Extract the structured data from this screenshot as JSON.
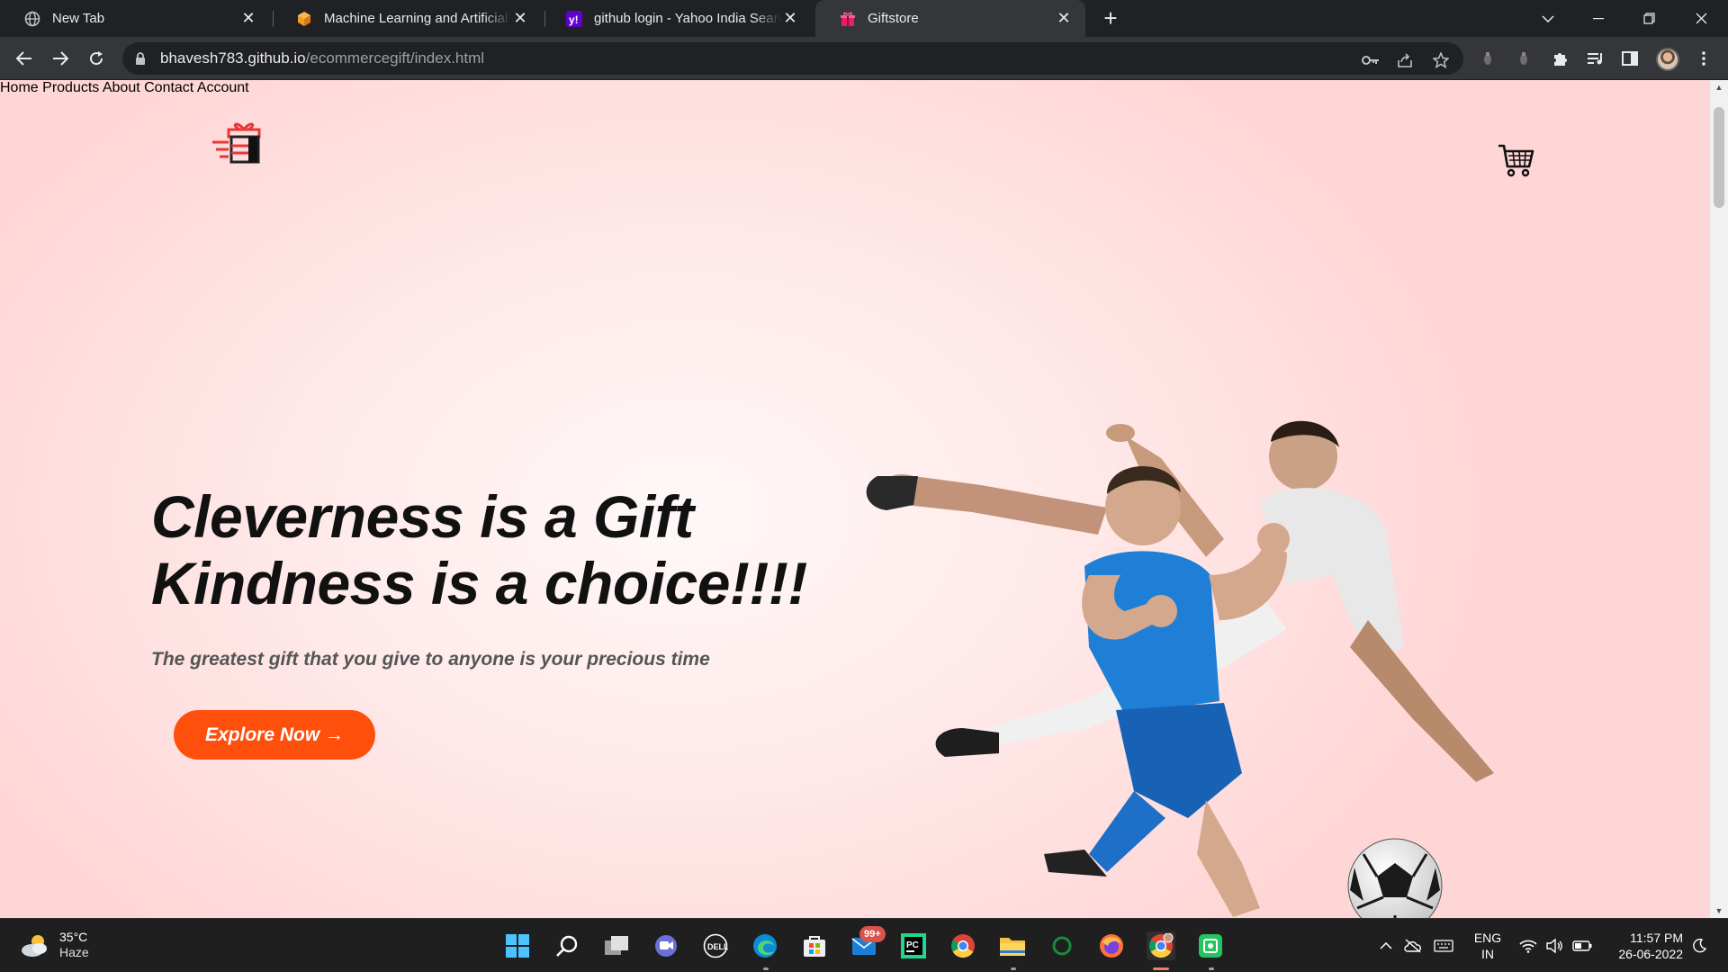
{
  "browser": {
    "tabs": [
      {
        "title": "New Tab",
        "icon": "globe-icon",
        "active": false
      },
      {
        "title": "Machine Learning and Artificial Intelligence",
        "icon": "orange-cube-icon",
        "active": false
      },
      {
        "title": "github login - Yahoo India Search Results",
        "icon": "yahoo-icon",
        "active": false
      },
      {
        "title": "Giftstore",
        "icon": "gift-icon",
        "active": true
      }
    ],
    "url_host": "bhavesh783.github.io",
    "url_path": "/ecommercegift/index.html",
    "window_controls": [
      "minimize",
      "restore",
      "close"
    ]
  },
  "site": {
    "nav": [
      {
        "label": "Home"
      },
      {
        "label": "Products"
      },
      {
        "label": "About"
      },
      {
        "label": "Contact"
      },
      {
        "label": "Account"
      }
    ],
    "hero": {
      "headline_line1": "Cleverness is a Gift",
      "headline_line2": "Kindness is a choice!!!!",
      "subtitle": "The greatest gift that you give to anyone is your precious time",
      "cta_label": "Explore Now →"
    },
    "accent_color": "#ff4f0c"
  },
  "taskbar": {
    "weather_temp": "35°C",
    "weather_desc": "Haze",
    "mail_badge": "99+",
    "lang_line1": "ENG",
    "lang_line2": "IN",
    "time": "11:57 PM",
    "date": "26-06-2022"
  }
}
